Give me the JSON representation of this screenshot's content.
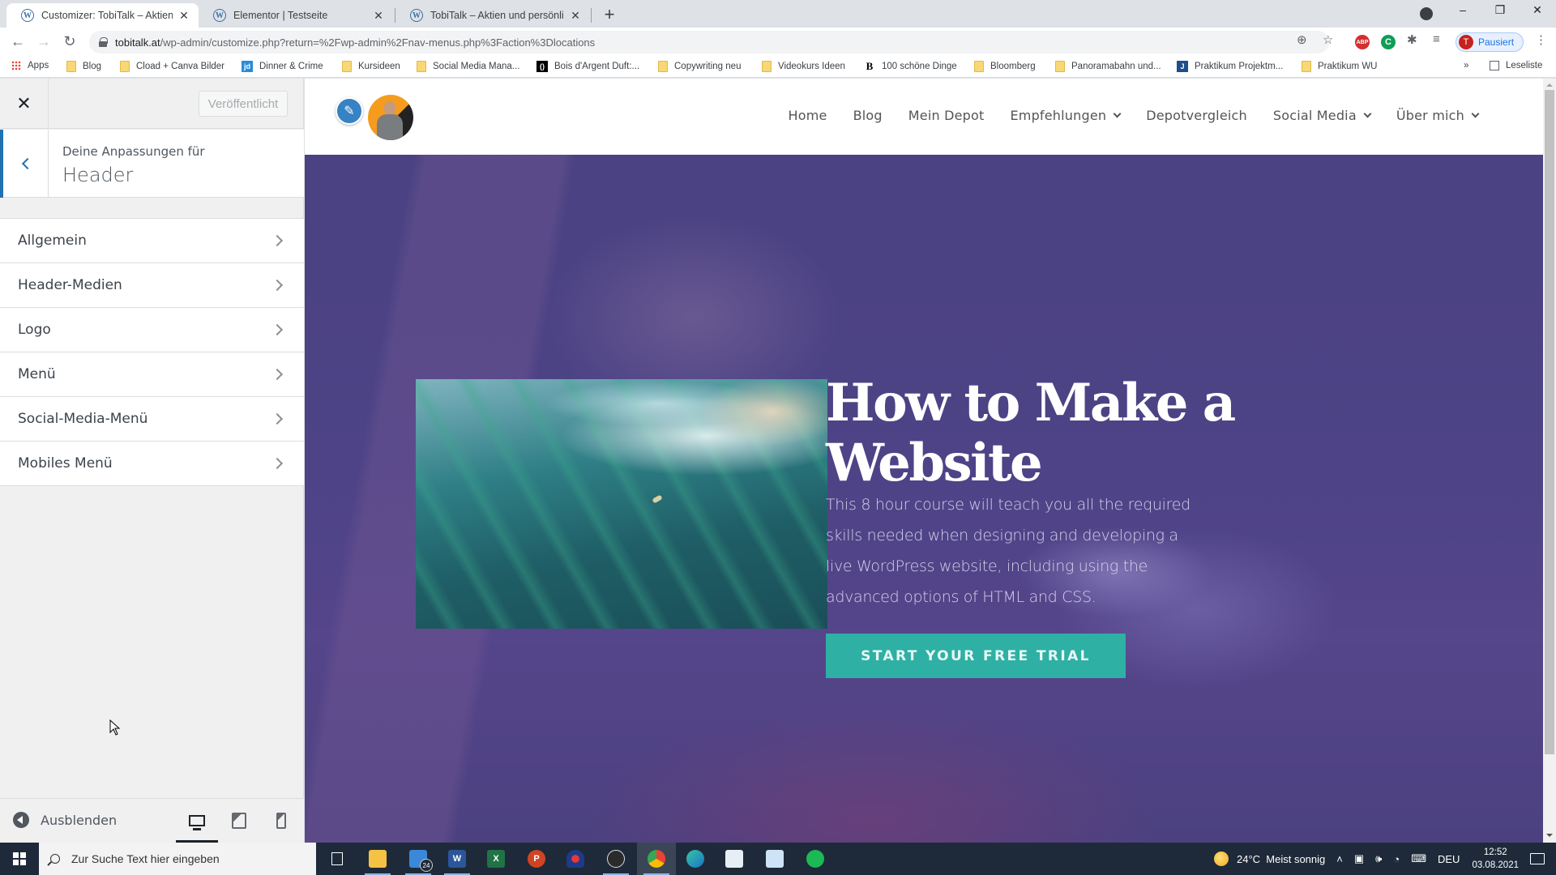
{
  "browser": {
    "tabs": [
      {
        "title": "Customizer: TobiTalk – Aktien und persönliche",
        "active": true
      },
      {
        "title": "Elementor | Testseite",
        "active": false
      },
      {
        "title": "TobiTalk – Aktien und persönliche",
        "active": false
      }
    ],
    "new_tab_icon": "+",
    "window_controls": {
      "minimize": "–",
      "restore": "❐",
      "close": "✕"
    },
    "url_host": "tobitalk.at",
    "url_path": "/wp-admin/customize.php?return=%2Fwp-admin%2Fnav-menus.php%3Faction%3Dlocations",
    "profile_initial": "T",
    "profile_status": "Pausiert",
    "extensions": [
      "ABP",
      "C"
    ],
    "bookmarks": [
      {
        "label": "Apps",
        "icon": "apps-grid"
      },
      {
        "label": "Blog",
        "icon": "folder"
      },
      {
        "label": "Cload + Canva Bilder",
        "icon": "folder"
      },
      {
        "label": "Dinner & Crime",
        "icon": "jd"
      },
      {
        "label": "Kursideen",
        "icon": "folder"
      },
      {
        "label": "Social Media Mana...",
        "icon": "folder"
      },
      {
        "label": "Bois d'Argent Duft:...",
        "icon": "()"
      },
      {
        "label": "Copywriting neu",
        "icon": "folder"
      },
      {
        "label": "Videokurs Ideen",
        "icon": "folder"
      },
      {
        "label": "100 schöne Dinge",
        "icon": "B"
      },
      {
        "label": "Bloomberg",
        "icon": "folder"
      },
      {
        "label": "Panoramabahn und...",
        "icon": "folder"
      },
      {
        "label": "Praktikum Projektm...",
        "icon": "J"
      },
      {
        "label": "Praktikum WU",
        "icon": "folder"
      }
    ],
    "bookmarks_overflow": "»",
    "reading_list": "Leseliste"
  },
  "customizer": {
    "close_icon": "✕",
    "publish_label": "Veröffentlicht",
    "section_subtitle": "Deine Anpassungen für",
    "section_title": "Header",
    "items": [
      {
        "label": "Allgemein"
      },
      {
        "label": "Header-Medien"
      },
      {
        "label": "Logo"
      },
      {
        "label": "Menü"
      },
      {
        "label": "Social-Media-Menü"
      },
      {
        "label": "Mobiles Menü"
      }
    ],
    "collapse_label": "Ausblenden",
    "devices": [
      {
        "name": "desktop",
        "active": true
      },
      {
        "name": "tablet",
        "active": false
      },
      {
        "name": "mobile",
        "active": false
      }
    ]
  },
  "site": {
    "edit_icon": "✎",
    "nav": [
      {
        "label": "Home",
        "dropdown": false
      },
      {
        "label": "Blog",
        "dropdown": false
      },
      {
        "label": "Mein Depot",
        "dropdown": false
      },
      {
        "label": "Empfehlungen",
        "dropdown": true
      },
      {
        "label": "Depotvergleich",
        "dropdown": false
      },
      {
        "label": "Social Media",
        "dropdown": true
      },
      {
        "label": "Über mich",
        "dropdown": true
      }
    ],
    "hero": {
      "title": "How to Make a Website",
      "text": "This 8 hour course will teach you all the required skills needed when designing and developing a live WordPress website, including using the advanced options of HTML and CSS.",
      "cta": "START YOUR FREE TRIAL",
      "cta_color": "#2fb0a4"
    }
  },
  "taskbar": {
    "search_placeholder": "Zur Suche Text hier eingeben",
    "mail_badge": "24",
    "weather_temp": "24°C",
    "weather_text": "Meist sonnig",
    "language": "DEU",
    "time": "12:52",
    "date": "03.08.2021"
  }
}
